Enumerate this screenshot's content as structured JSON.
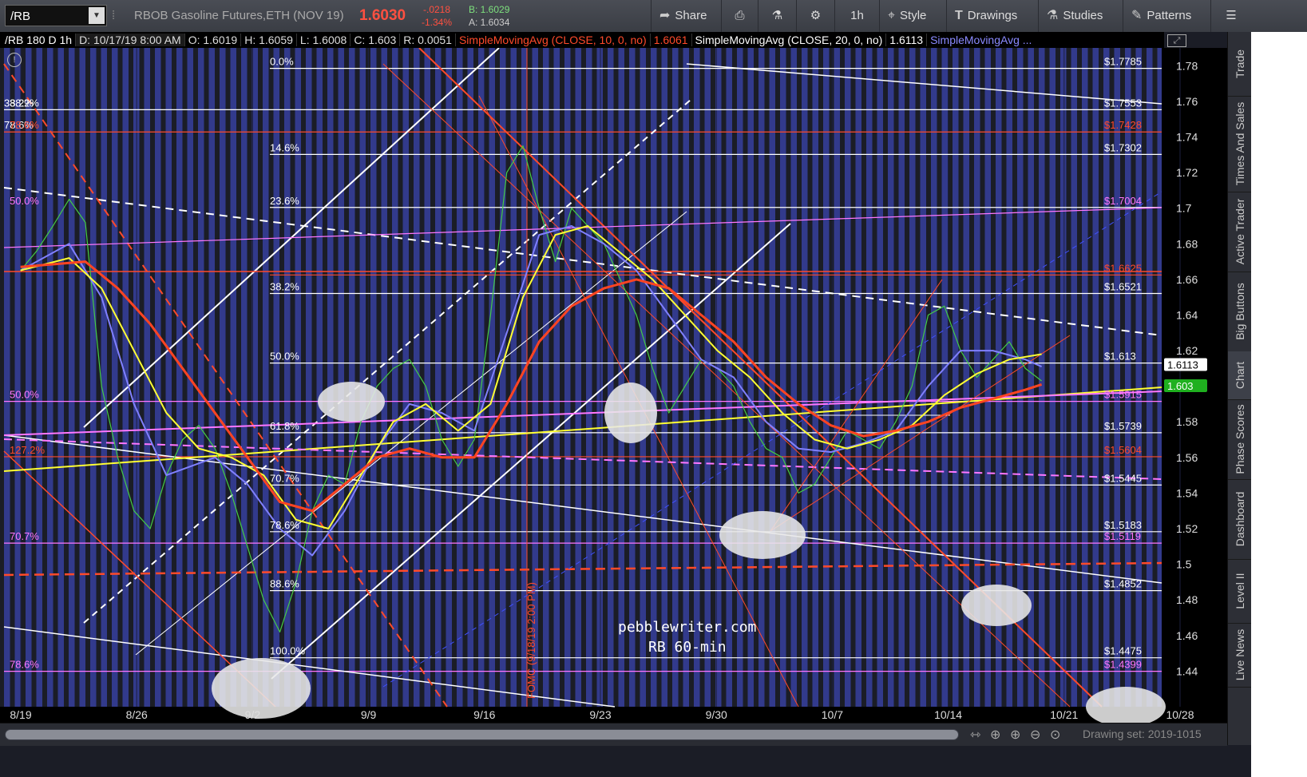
{
  "toolbar": {
    "symbol": "/RB",
    "instrument_name": "RBOB Gasoline Futures,ETH (NOV 19)",
    "last_price": "1.6030",
    "net_change": "-.0218",
    "pct_change": "-1.34%",
    "bid": "B: 1.6029",
    "ask": "A: 1.6034",
    "share": "Share",
    "timeframe": "1h",
    "style": "Style",
    "drawings": "Drawings",
    "studies": "Studies",
    "patterns": "Patterns"
  },
  "header_line": {
    "title": "/RB 180 D 1h",
    "date": "D: 10/17/19 8:00 AM",
    "open": "O: 1.6019",
    "high": "H: 1.6059",
    "low": "L: 1.6008",
    "close": "C: 1.603",
    "range": "R: 0.0051",
    "sma10_label": "SimpleMovingAvg (CLOSE, 10, 0, no)",
    "sma10_value": "1.6061",
    "sma20_label": "SimpleMovingAvg (CLOSE, 20, 0, no)",
    "sma20_value": "1.6113",
    "sma_more": "SimpleMovingAvg ..."
  },
  "right_tabs": [
    "Trade",
    "Times And Sales",
    "Active Trader",
    "Big Buttons",
    "Chart",
    "Phase Scores",
    "Dashboard",
    "Level II",
    "Live News"
  ],
  "bottom": {
    "drawing_set": "Drawing set: 2019-1015"
  },
  "watermark": {
    "line1": "pebblewriter.com",
    "line2": "RB  60-min"
  },
  "fomc_label": "FOMC (9/18/19 2:00 PM)",
  "colors": {
    "background": "#1b1d26",
    "stripe": "#323a8c",
    "sma10": "#ffffff",
    "sma20": "#8080ff",
    "sma50": "#ffff33",
    "sma100": "#ff4422",
    "fib_white": "#ffffff",
    "fib_red": "#ff4a2a",
    "fib_magenta": "#ff77ff",
    "last_price_badge": "#1fb01f",
    "sma20_badge": "#ffffff"
  },
  "chart_data": {
    "type": "line",
    "title": "/RB 180 D 1h",
    "x_tick_labels": [
      "8/19",
      "8/26",
      "9/2",
      "9/9",
      "9/16",
      "9/23",
      "9/30",
      "10/7",
      "10/14",
      "10/21",
      "10/28"
    ],
    "y_range": [
      1.42,
      1.79
    ],
    "y_ticks": [
      1.44,
      1.46,
      1.48,
      1.5,
      1.52,
      1.54,
      1.56,
      1.58,
      1.6,
      1.62,
      1.64,
      1.66,
      1.68,
      1.7,
      1.72,
      1.74,
      1.76,
      1.78
    ],
    "y_tick_labels": [
      "1.44",
      "1.46",
      "1.48",
      "1.5",
      "1.52",
      "1.54",
      "1.56",
      "1.58",
      "1.6",
      "1.62",
      "1.64",
      "1.66",
      "1.68",
      "1.7",
      "1.72",
      "1.74",
      "1.76",
      "1.78"
    ],
    "price_badges": [
      {
        "label": "1.6113",
        "value": 1.6113,
        "bg": "#ffffff",
        "fg": "#000000"
      },
      {
        "label": "1.603",
        "value": 1.603,
        "bg": "#1fb01f",
        "fg": "#ffffff"
      }
    ],
    "series": [
      {
        "key": "price",
        "color": "#44cc44",
        "points": [
          [
            0,
            1.665
          ],
          [
            1,
            1.676
          ],
          [
            2,
            1.69
          ],
          [
            3,
            1.705
          ],
          [
            4,
            1.692
          ],
          [
            5,
            1.6
          ],
          [
            6,
            1.56
          ],
          [
            7,
            1.53
          ],
          [
            8,
            1.52
          ],
          [
            9,
            1.55
          ],
          [
            10,
            1.57
          ],
          [
            11,
            1.578
          ],
          [
            12,
            1.565
          ],
          [
            13,
            1.54
          ],
          [
            14,
            1.51
          ],
          [
            15,
            1.48
          ],
          [
            16,
            1.462
          ],
          [
            17,
            1.49
          ],
          [
            18,
            1.53
          ],
          [
            19,
            1.55
          ],
          [
            20,
            1.545
          ],
          [
            21,
            1.58
          ],
          [
            22,
            1.6
          ],
          [
            23,
            1.61
          ],
          [
            24,
            1.615
          ],
          [
            25,
            1.6
          ],
          [
            26,
            1.57
          ],
          [
            27,
            1.555
          ],
          [
            28,
            1.57
          ],
          [
            29,
            1.64
          ],
          [
            30,
            1.72
          ],
          [
            31,
            1.735
          ],
          [
            32,
            1.7
          ],
          [
            33,
            1.67
          ],
          [
            34,
            1.7
          ],
          [
            35,
            1.69
          ],
          [
            36,
            1.68
          ],
          [
            37,
            1.66
          ],
          [
            38,
            1.64
          ],
          [
            39,
            1.61
          ],
          [
            40,
            1.585
          ],
          [
            41,
            1.6
          ],
          [
            42,
            1.615
          ],
          [
            43,
            1.61
          ],
          [
            44,
            1.6
          ],
          [
            45,
            1.58
          ],
          [
            46,
            1.565
          ],
          [
            47,
            1.56
          ],
          [
            48,
            1.54
          ],
          [
            49,
            1.545
          ],
          [
            50,
            1.56
          ],
          [
            51,
            1.575
          ],
          [
            52,
            1.57
          ],
          [
            53,
            1.565
          ],
          [
            54,
            1.58
          ],
          [
            55,
            1.6
          ],
          [
            56,
            1.64
          ],
          [
            57,
            1.645
          ],
          [
            58,
            1.62
          ],
          [
            59,
            1.605
          ],
          [
            60,
            1.615
          ],
          [
            61,
            1.625
          ],
          [
            62,
            1.61
          ],
          [
            63,
            1.603
          ]
        ]
      },
      {
        "key": "sma20",
        "color": "#8080ff",
        "points": [
          [
            0,
            1.665
          ],
          [
            3,
            1.68
          ],
          [
            5,
            1.65
          ],
          [
            7,
            1.59
          ],
          [
            9,
            1.55
          ],
          [
            12,
            1.56
          ],
          [
            14,
            1.545
          ],
          [
            16,
            1.52
          ],
          [
            18,
            1.505
          ],
          [
            20,
            1.53
          ],
          [
            22,
            1.565
          ],
          [
            24,
            1.59
          ],
          [
            26,
            1.585
          ],
          [
            28,
            1.575
          ],
          [
            30,
            1.63
          ],
          [
            32,
            1.685
          ],
          [
            34,
            1.69
          ],
          [
            36,
            1.68
          ],
          [
            38,
            1.665
          ],
          [
            40,
            1.64
          ],
          [
            42,
            1.615
          ],
          [
            44,
            1.605
          ],
          [
            46,
            1.58
          ],
          [
            48,
            1.565
          ],
          [
            50,
            1.563
          ],
          [
            52,
            1.568
          ],
          [
            54,
            1.575
          ],
          [
            56,
            1.6
          ],
          [
            58,
            1.62
          ],
          [
            60,
            1.62
          ],
          [
            62,
            1.615
          ],
          [
            63,
            1.611
          ]
        ]
      },
      {
        "key": "sma50",
        "color": "#ffff33",
        "points": [
          [
            0,
            1.665
          ],
          [
            3,
            1.672
          ],
          [
            5,
            1.655
          ],
          [
            7,
            1.62
          ],
          [
            9,
            1.585
          ],
          [
            11,
            1.565
          ],
          [
            13,
            1.56
          ],
          [
            15,
            1.55
          ],
          [
            17,
            1.525
          ],
          [
            19,
            1.52
          ],
          [
            21,
            1.55
          ],
          [
            23,
            1.58
          ],
          [
            25,
            1.59
          ],
          [
            27,
            1.575
          ],
          [
            29,
            1.59
          ],
          [
            31,
            1.65
          ],
          [
            33,
            1.685
          ],
          [
            35,
            1.69
          ],
          [
            37,
            1.675
          ],
          [
            39,
            1.66
          ],
          [
            41,
            1.64
          ],
          [
            43,
            1.62
          ],
          [
            45,
            1.605
          ],
          [
            47,
            1.585
          ],
          [
            49,
            1.57
          ],
          [
            51,
            1.565
          ],
          [
            53,
            1.57
          ],
          [
            55,
            1.578
          ],
          [
            57,
            1.595
          ],
          [
            59,
            1.607
          ],
          [
            61,
            1.615
          ],
          [
            63,
            1.618
          ]
        ]
      },
      {
        "key": "sma100",
        "color": "#ff4422",
        "points": [
          [
            0,
            1.667
          ],
          [
            4,
            1.67
          ],
          [
            6,
            1.655
          ],
          [
            8,
            1.635
          ],
          [
            10,
            1.61
          ],
          [
            12,
            1.585
          ],
          [
            14,
            1.56
          ],
          [
            16,
            1.535
          ],
          [
            18,
            1.53
          ],
          [
            20,
            1.545
          ],
          [
            22,
            1.56
          ],
          [
            24,
            1.565
          ],
          [
            26,
            1.56
          ],
          [
            28,
            1.56
          ],
          [
            30,
            1.59
          ],
          [
            32,
            1.625
          ],
          [
            34,
            1.645
          ],
          [
            36,
            1.655
          ],
          [
            38,
            1.66
          ],
          [
            40,
            1.655
          ],
          [
            42,
            1.64
          ],
          [
            44,
            1.625
          ],
          [
            46,
            1.605
          ],
          [
            48,
            1.59
          ],
          [
            50,
            1.578
          ],
          [
            52,
            1.572
          ],
          [
            54,
            1.575
          ],
          [
            56,
            1.58
          ],
          [
            58,
            1.588
          ],
          [
            60,
            1.593
          ],
          [
            62,
            1.598
          ],
          [
            63,
            1.601
          ]
        ]
      }
    ],
    "fib_levels": [
      {
        "pct": "0.0%",
        "price": "$1.7785",
        "value": 1.7785,
        "color": "#ffffff",
        "left": true
      },
      {
        "pct": "38.2%",
        "price": "$1.7553",
        "value": 1.7553,
        "color": "#ffffff",
        "left": false
      },
      {
        "pct": "78.6%",
        "price": "$1.7428",
        "value": 1.7428,
        "color": "#ff4a2a",
        "left": false
      },
      {
        "pct": "14.6%",
        "price": "$1.7302",
        "value": 1.7302,
        "color": "#ffffff",
        "left": true
      },
      {
        "pct": "23.6%",
        "price": "$1.7004",
        "value": 1.7004,
        "color": "#ffffff",
        "left": true,
        "price_color": "#ff77ff"
      },
      {
        "pct": "",
        "price": "$1.6625",
        "value": 1.6625,
        "color": "#ff4a2a",
        "left": true
      },
      {
        "pct": "38.2%",
        "price": "$1.6521",
        "value": 1.6521,
        "color": "#ffffff",
        "left": true
      },
      {
        "pct": "50.0%",
        "price": "$1.613",
        "value": 1.613,
        "color": "#ffffff",
        "left": true
      },
      {
        "pct": "",
        "price": "$1.5915",
        "value": 1.5915,
        "color": "#ff77ff",
        "left": false
      },
      {
        "pct": "61.8%",
        "price": "$1.5739",
        "value": 1.5739,
        "color": "#ffffff",
        "left": true
      },
      {
        "pct": "",
        "price": "$1.5604",
        "value": 1.5604,
        "color": "#ff4a2a",
        "left": false
      },
      {
        "pct": "70.7%",
        "price": "$1.5445",
        "value": 1.5445,
        "color": "#ffffff",
        "left": true
      },
      {
        "pct": "78.6%",
        "price": "$1.5183",
        "value": 1.5183,
        "color": "#ffffff",
        "left": true
      },
      {
        "pct": "",
        "price": "$1.5119",
        "value": 1.5119,
        "color": "#ff77ff",
        "left": false
      },
      {
        "pct": "88.6%",
        "price": "$1.4852",
        "value": 1.4852,
        "color": "#ffffff",
        "left": true
      },
      {
        "pct": "100.0%",
        "price": "$1.4475",
        "value": 1.4475,
        "color": "#ffffff",
        "left": true
      },
      {
        "pct": "",
        "price": "$1.4399",
        "value": 1.4399,
        "color": "#ff77ff",
        "left": false
      }
    ],
    "left_level_labels": [
      {
        "text": "38.2%",
        "value": 1.7553,
        "color": "#ffffff"
      },
      {
        "text": "78.6%",
        "value": 1.7428,
        "color": "#ff4a2a"
      },
      {
        "text": "50.0%",
        "value": 1.7004,
        "color": "#ff77ff"
      },
      {
        "text": "50.0%",
        "value": 1.5915,
        "color": "#ff77ff"
      },
      {
        "text": "127.2%",
        "value": 1.5604,
        "color": "#ff4a2a"
      },
      {
        "text": "70.7%",
        "value": 1.5119,
        "color": "#ff77ff"
      },
      {
        "text": "78.6%",
        "value": 1.4399,
        "color": "#ff77ff"
      }
    ]
  }
}
